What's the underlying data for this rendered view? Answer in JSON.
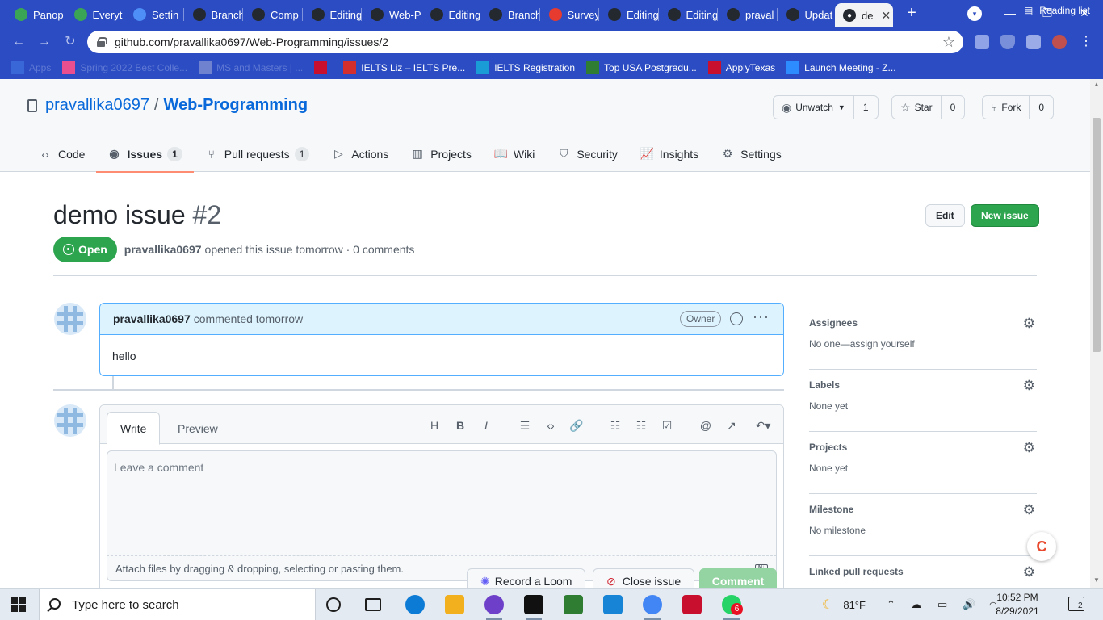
{
  "browser": {
    "tabs": [
      {
        "label": "Panop",
        "icon": "panopto-icon",
        "color": "#3aa655"
      },
      {
        "label": "Everyt",
        "icon": "everything-icon",
        "color": "#3aa655"
      },
      {
        "label": "Settin",
        "icon": "settings-gear-icon",
        "color": "#4d8ef7"
      },
      {
        "label": "Branch",
        "icon": "github-icon",
        "color": "#24292f"
      },
      {
        "label": "Comp",
        "icon": "github-icon",
        "color": "#24292f"
      },
      {
        "label": "Editing",
        "icon": "github-icon",
        "color": "#24292f"
      },
      {
        "label": "Web-P",
        "icon": "github-icon",
        "color": "#24292f"
      },
      {
        "label": "Editing",
        "icon": "github-icon",
        "color": "#24292f"
      },
      {
        "label": "Branch",
        "icon": "github-icon",
        "color": "#24292f"
      },
      {
        "label": "Survey",
        "icon": "survey-icon",
        "color": "#e63b2e"
      },
      {
        "label": "Editing",
        "icon": "github-icon",
        "color": "#24292f"
      },
      {
        "label": "Editing",
        "icon": "github-icon",
        "color": "#24292f"
      },
      {
        "label": "praval",
        "icon": "github-icon",
        "color": "#24292f"
      },
      {
        "label": "Updat",
        "icon": "github-icon",
        "color": "#24292f"
      }
    ],
    "active_tab": {
      "label": "de",
      "close": "✕"
    },
    "new_tab": "+",
    "controls": {
      "minimize": "—",
      "maximize": "❐",
      "close": "✕"
    },
    "url": "github.com/pravallika0697/Web-Programming/issues/2",
    "bookmarks": [
      {
        "label": "Apps",
        "icon": "apps-grid-icon",
        "faded": true
      },
      {
        "label": "Spring 2022 Best Colle...",
        "icon": "colorful-square-icon",
        "faded": true
      },
      {
        "label": "MS and Masters | ...",
        "icon": "globe-icon",
        "faded": true
      },
      {
        "label": "",
        "icon": "shield-crest-icon",
        "faded": false
      },
      {
        "label": "IELTS Liz – IELTS Pre...",
        "icon": "liz-icon",
        "faded": false
      },
      {
        "label": "IELTS Registration",
        "icon": "ielts-icon",
        "faded": false
      },
      {
        "label": "Top USA Postgradu...",
        "icon": "h-logo-icon",
        "faded": false
      },
      {
        "label": "ApplyTexas",
        "icon": "red-star-icon",
        "faded": false
      },
      {
        "label": "Launch Meeting - Z...",
        "icon": "zoom-icon",
        "faded": false
      }
    ],
    "reading_list": "Reading list"
  },
  "repo": {
    "owner": "pravallika0697",
    "name": "Web-Programming",
    "separator": "/",
    "unwatch": {
      "label": "Unwatch",
      "count": "1"
    },
    "star": {
      "label": "Star",
      "count": "0"
    },
    "fork": {
      "label": "Fork",
      "count": "0"
    },
    "nav": [
      {
        "label": "Code",
        "icon": "code-icon",
        "glyph": "‹›",
        "counter": ""
      },
      {
        "label": "Issues",
        "icon": "issue-opened-icon",
        "glyph": "◉",
        "counter": "1",
        "selected": true
      },
      {
        "label": "Pull requests",
        "icon": "git-pull-request-icon",
        "glyph": "⑂",
        "counter": "1"
      },
      {
        "label": "Actions",
        "icon": "play-icon",
        "glyph": "▷",
        "counter": ""
      },
      {
        "label": "Projects",
        "icon": "project-icon",
        "glyph": "▥",
        "counter": ""
      },
      {
        "label": "Wiki",
        "icon": "book-icon",
        "glyph": "📖",
        "counter": ""
      },
      {
        "label": "Security",
        "icon": "shield-icon",
        "glyph": "⛉",
        "counter": ""
      },
      {
        "label": "Insights",
        "icon": "graph-icon",
        "glyph": "📈",
        "counter": ""
      },
      {
        "label": "Settings",
        "icon": "gear-icon",
        "glyph": "⚙",
        "counter": ""
      }
    ]
  },
  "issue": {
    "title": "demo issue",
    "number": "#2",
    "state": "Open",
    "author": "pravallika0697",
    "meta_text": "opened this issue tomorrow · 0 comments",
    "edit_label": "Edit",
    "new_issue_label": "New issue"
  },
  "comment": {
    "author": "pravallika0697",
    "action": "commented tomorrow",
    "role": "Owner",
    "body": "hello"
  },
  "editor": {
    "tab_write": "Write",
    "tab_preview": "Preview",
    "placeholder": "Leave a comment",
    "attach_text": "Attach files by dragging & dropping, selecting or pasting them.",
    "markdown_badge": "M↓",
    "tools": [
      {
        "name": "heading-icon",
        "glyph": "H"
      },
      {
        "name": "bold-icon",
        "glyph": "B"
      },
      {
        "name": "italic-icon",
        "glyph": "I"
      },
      {
        "name": "quote-icon",
        "glyph": "☰"
      },
      {
        "name": "code-icon",
        "glyph": "‹›"
      },
      {
        "name": "link-icon",
        "glyph": "🔗"
      },
      {
        "name": "bulleted-list-icon",
        "glyph": "☷"
      },
      {
        "name": "numbered-list-icon",
        "glyph": "☷"
      },
      {
        "name": "task-list-icon",
        "glyph": "☑"
      },
      {
        "name": "mention-icon",
        "glyph": "@"
      },
      {
        "name": "cross-reference-icon",
        "glyph": "↗"
      },
      {
        "name": "saved-replies-icon",
        "glyph": "↶▾"
      }
    ],
    "record_loom": "Record a Loom",
    "close_issue": "Close issue",
    "comment_btn": "Comment"
  },
  "sidebar": {
    "sections": [
      {
        "heading": "Assignees",
        "value": "No one—assign yourself"
      },
      {
        "heading": "Labels",
        "value": "None yet"
      },
      {
        "heading": "Projects",
        "value": "None yet"
      },
      {
        "heading": "Milestone",
        "value": "No milestone"
      },
      {
        "heading": "Linked pull requests",
        "value": ""
      }
    ]
  },
  "taskbar": {
    "search_placeholder": "Type here to search",
    "apps": [
      {
        "name": "cortana-icon",
        "color": "#1e1e1e"
      },
      {
        "name": "task-view-icon",
        "color": "#1e1e1e"
      },
      {
        "name": "edge-icon",
        "color": "#0c7bd6"
      },
      {
        "name": "file-explorer-icon",
        "color": "#f2b01e"
      },
      {
        "name": "github-desktop-icon",
        "color": "#6e40c9"
      },
      {
        "name": "webstorm-icon",
        "color": "#111111"
      },
      {
        "name": "app-green-icon",
        "color": "#2e7d32"
      },
      {
        "name": "settings-app-icon",
        "color": "#1784d6"
      },
      {
        "name": "chrome-icon",
        "color": "#4285f4"
      },
      {
        "name": "mcafee-icon",
        "color": "#c8102e"
      },
      {
        "name": "whatsapp-icon",
        "color": "#25d366"
      }
    ],
    "whatsapp_badge": "6",
    "weather": "81°F",
    "time": "10:52 PM",
    "date": "8/29/2021",
    "notifications": "2"
  }
}
